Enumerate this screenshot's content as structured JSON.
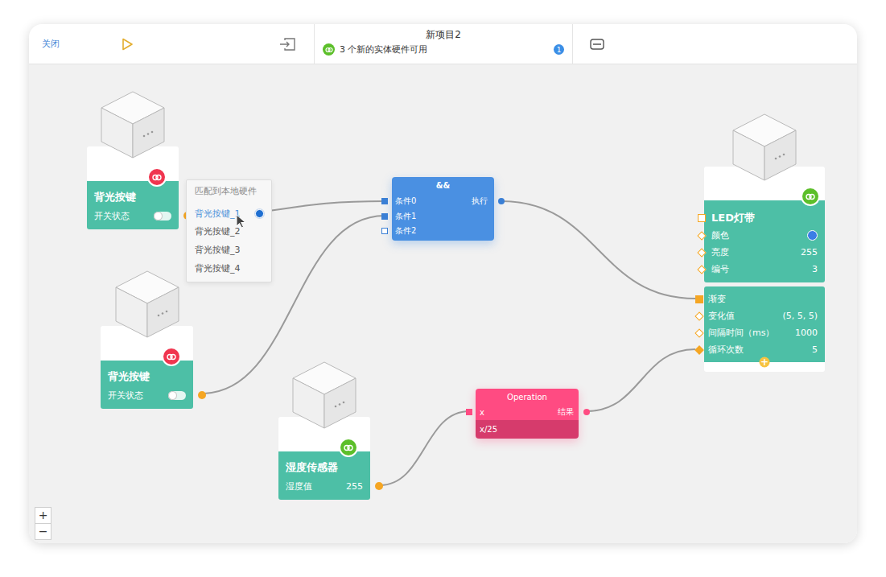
{
  "toolbar": {
    "close": "关闭",
    "title": "新项目2",
    "notice": "3 个新的实体硬件可用",
    "notice_count": "1"
  },
  "hardware": [
    {
      "title": "背光按键",
      "field": "开关状态",
      "kind": "toggle",
      "on": false,
      "matched": false
    },
    {
      "title": "背光按键",
      "field": "开关状态",
      "kind": "toggle",
      "on": false,
      "matched": false
    },
    {
      "title": "湿度传感器",
      "field": "湿度值",
      "kind": "value",
      "value": "255",
      "matched": true
    }
  ],
  "match_menu": {
    "header": "匹配到本地硬件",
    "items": [
      {
        "label": "背光按键_1",
        "selected": true
      },
      {
        "label": "背光按键_2",
        "selected": false
      },
      {
        "label": "背光按键_3",
        "selected": false
      },
      {
        "label": "背光按键_4",
        "selected": false
      }
    ]
  },
  "and_node": {
    "title": "&&",
    "inputs": [
      {
        "label": "条件0",
        "connected": true
      },
      {
        "label": "条件1",
        "connected": true
      },
      {
        "label": "条件2",
        "connected": false
      }
    ],
    "output": "执行"
  },
  "operation_node": {
    "title": "Operation",
    "input": "x",
    "output": "结果",
    "expression": "x/25"
  },
  "led_node": {
    "title": "LED灯带",
    "matched": true,
    "rows": [
      {
        "label": "颜色",
        "kind": "color",
        "color": "#3b7ee6"
      },
      {
        "label": "亮度",
        "kind": "value",
        "value": "255"
      },
      {
        "label": "编号",
        "kind": "value",
        "value": "3"
      }
    ]
  },
  "effect_block": {
    "title": "渐变",
    "connected": true,
    "rows": [
      {
        "label": "变化值",
        "value": "(5, 5, 5)",
        "connected": false
      },
      {
        "label": "间隔时间（ms）",
        "value": "1000",
        "connected": false
      },
      {
        "label": "循环次数",
        "value": "5",
        "connected": true
      }
    ],
    "add": "+"
  },
  "zoom": [
    "+",
    "−"
  ]
}
